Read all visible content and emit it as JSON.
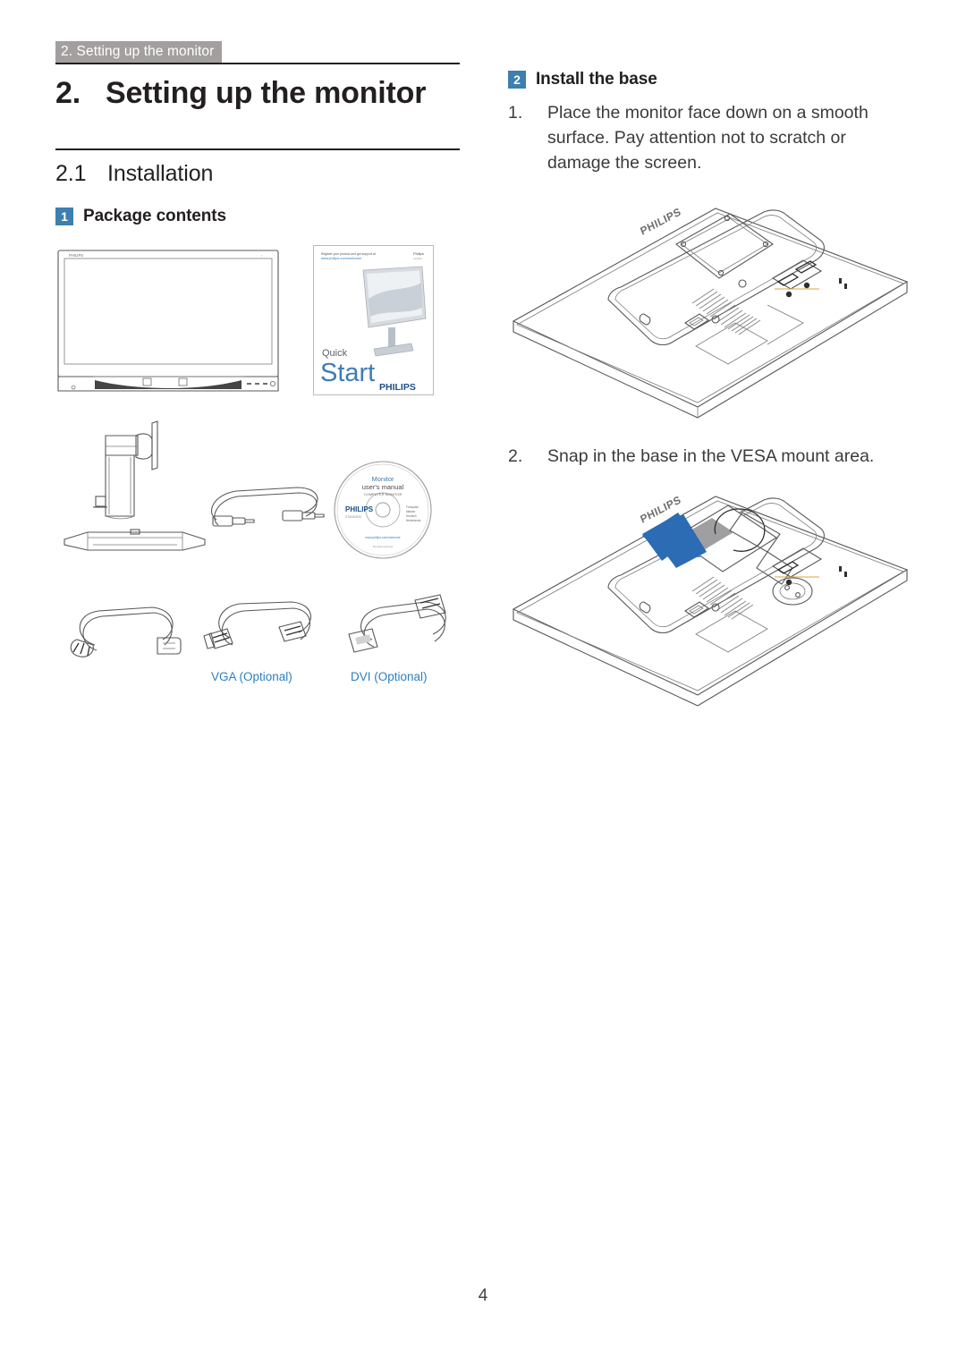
{
  "header": {
    "breadcrumb": "2. Setting up the monitor"
  },
  "left_column": {
    "chapter_number": "2.",
    "chapter_title": "Setting up the monitor",
    "section_number": "2.1",
    "section_title": "Installation",
    "subsection": {
      "badge": "1",
      "label": "Package contents"
    },
    "figures": {
      "monitor": {
        "name": "monitor-front-view",
        "brand": "PHILIPS"
      },
      "quick_start": {
        "name": "quick-start-guide",
        "url_line1": "Register your product and get support at",
        "url_line2": "www.philips.com/welcome",
        "corner_mark": "Philips",
        "word_quick": "Quick",
        "word_start": "Start",
        "brand": "PHILIPS"
      },
      "stand": {
        "name": "monitor-stand-column"
      },
      "base": {
        "name": "monitor-base-plate"
      },
      "audio_cable": {
        "name": "audio-cable"
      },
      "cd": {
        "name": "user-manual-cd",
        "title_line1": "Monitor",
        "title_line2": "user's manual",
        "title_line3": "COMPUTER MONITOR",
        "brand": "PHILIPS",
        "model": "STANDARD"
      },
      "power_cable": {
        "name": "power-cable"
      },
      "vga_cable": {
        "name": "vga-cable",
        "label": "VGA (Optional)"
      },
      "dvi_cable": {
        "name": "dvi-cable",
        "label": "DVI (Optional)"
      }
    }
  },
  "right_column": {
    "subsection": {
      "badge": "2",
      "label": "Install the base"
    },
    "steps": [
      {
        "marker": "1.",
        "text": "Place the monitor face down on a smooth surface. Pay attention not to scratch or damage the screen."
      },
      {
        "marker": "2.",
        "text": "Snap in the base in the VESA mount area."
      }
    ],
    "figures": {
      "monitor_face_down": {
        "name": "monitor-face-down-vesa",
        "brand": "PHILIPS"
      },
      "snap_base": {
        "name": "monitor-snap-base-vesa",
        "brand": "PHILIPS",
        "arrow": "insert-direction-arrow"
      }
    }
  },
  "footer": {
    "page_number": "4"
  },
  "colors": {
    "breadcrumb_band": "#a39f9f",
    "badge_blue": "#3d7fae",
    "cable_label_blue": "#2e7fc0",
    "arrow_blue": "#2b6cb4",
    "line_art": "#58585b"
  }
}
